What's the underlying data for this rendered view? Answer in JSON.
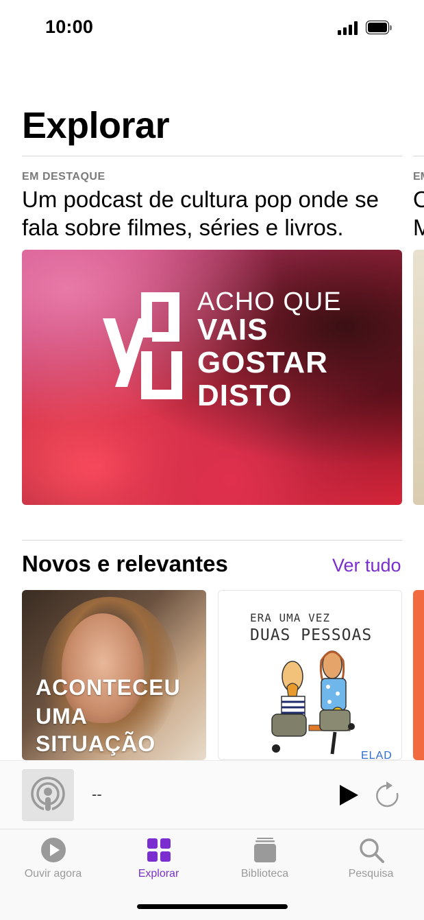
{
  "status_bar": {
    "time": "10:00"
  },
  "page": {
    "title": "Explorar"
  },
  "featured": {
    "label": "EM DESTAQUE",
    "description": "Um podcast de cultura pop onde se fala sobre filmes, séries e livros.",
    "artwork_lines": [
      "ACHO QUE",
      "VAIS",
      "GOSTAR",
      "DISTO"
    ],
    "peek_label": "EM",
    "peek_description_lines": [
      "O",
      "M"
    ]
  },
  "new_section": {
    "title": "Novos e relevantes",
    "see_all": "Ver tudo",
    "cards": [
      {
        "lines": [
          "ACONTECEU",
          "UMA",
          "SITUAÇÃO"
        ]
      },
      {
        "lines": [
          "ERA UMA VEZ",
          "DUAS PESSOAS"
        ],
        "footer": "ELAD"
      }
    ]
  },
  "mini_player": {
    "title": "--",
    "art_icon": "podcast-icon",
    "play_icon": "play-icon",
    "skip_icon": "skip-forward-icon"
  },
  "tabs": [
    {
      "label": "Ouvir agora",
      "icon": "play-circle-icon",
      "active": false
    },
    {
      "label": "Explorar",
      "icon": "grid-icon",
      "active": true
    },
    {
      "label": "Biblioteca",
      "icon": "library-icon",
      "active": false
    },
    {
      "label": "Pesquisa",
      "icon": "search-icon",
      "active": false
    }
  ],
  "colors": {
    "accent": "#7b2ecf",
    "inactive": "#9a9a9a"
  }
}
